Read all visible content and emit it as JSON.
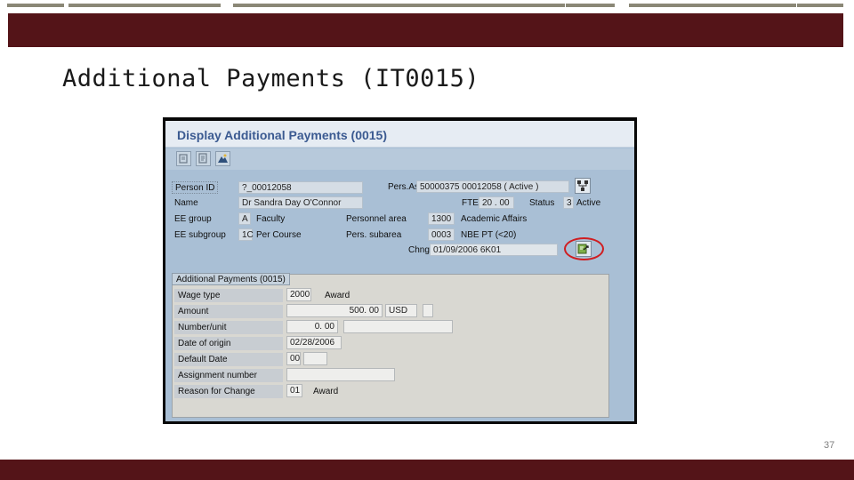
{
  "slide": {
    "title": "Additional Payments (IT0015)",
    "page_number": "37",
    "colors": {
      "accent_bar": "#541418",
      "sap_background": "#a9bfd5",
      "sap_title": "#3b5a91",
      "highlight": "#d01d20"
    }
  },
  "sap": {
    "window_title": "Display Additional Payments (0015)",
    "toolbar": {
      "icons": [
        "display-change-icon",
        "overview-icon",
        "mountain-icon"
      ]
    },
    "header": {
      "person_id_label": "Person ID",
      "person_id_value": "?_00012058",
      "pers_assgn_label": "Pers.Assgn",
      "pers_assgn_value": "50000375 00012058 ( Active )",
      "name_label": "Name",
      "name_value": "Dr  Sandra  Day  O'Connor",
      "fte_label": "FTE",
      "fte_value": "20 . 00",
      "status_label": "Status",
      "status_code": "3",
      "status_text": "Active",
      "ee_group_label": "EE group",
      "ee_group_code": "A",
      "ee_group_text": "Faculty",
      "personnel_area_label": "Personnel area",
      "personnel_area_code": "1300",
      "personnel_area_text": "Academic Affairs",
      "ee_subgroup_label": "EE subgroup",
      "ee_subgroup_code": "1C",
      "ee_subgroup_text": "Per Course",
      "pers_subarea_label": "Pers. subarea",
      "pers_subarea_code": "0003",
      "pers_subarea_text": "NBE PT (<20)",
      "chng_label": "Chng",
      "chng_value": "01/09/2006  6K01"
    },
    "group": {
      "title": "Additional Payments (0015)",
      "rows": {
        "wage_type": {
          "label": "Wage type",
          "code": "2000",
          "text": "Award"
        },
        "amount": {
          "label": "Amount",
          "value": "500. 00",
          "currency": "USD"
        },
        "number_unit": {
          "label": "Number/unit",
          "value": "0. 00"
        },
        "date_of_origin": {
          "label": "Date of origin",
          "value": "02/28/2006"
        },
        "default_date": {
          "label": "Default Date",
          "value": "00"
        },
        "assignment_number": {
          "label": "Assignment number"
        },
        "reason_for_change": {
          "label": "Reason for Change",
          "code": "01",
          "text": "Award"
        }
      }
    }
  }
}
